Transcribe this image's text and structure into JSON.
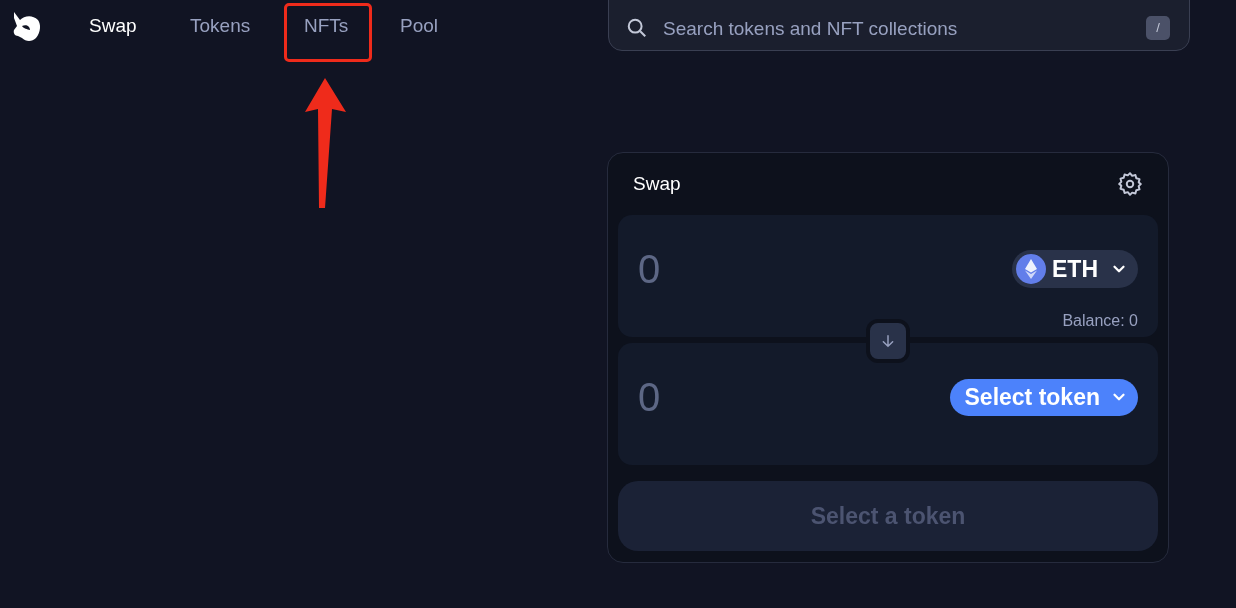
{
  "nav": {
    "items": [
      {
        "label": "Swap",
        "selected": true,
        "highlighted": false
      },
      {
        "label": "Tokens",
        "selected": false,
        "highlighted": false
      },
      {
        "label": "NFTs",
        "selected": false,
        "highlighted": true
      },
      {
        "label": "Pool",
        "selected": false,
        "highlighted": false
      }
    ]
  },
  "search": {
    "placeholder": "Search tokens and NFT collections",
    "shortcut": "/"
  },
  "swap": {
    "title": "Swap",
    "fields": [
      {
        "placeholder": "0",
        "token": {
          "kind": "token",
          "label": "ETH"
        },
        "balance": "Balance: 0"
      },
      {
        "placeholder": "0",
        "token": {
          "kind": "select",
          "label": "Select token"
        }
      }
    ],
    "action": {
      "label": "Select a token",
      "disabled": true
    }
  }
}
